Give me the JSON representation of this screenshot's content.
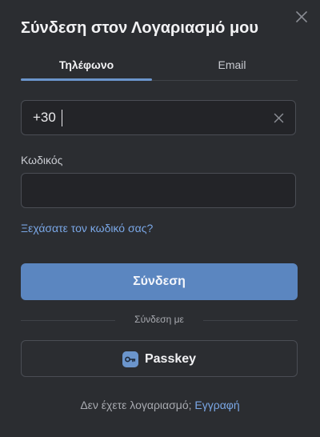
{
  "dialog": {
    "title": "Σύνδεση στον Λογαριασμό μου"
  },
  "tabs": {
    "phone": "Τηλέφωνο",
    "email": "Email"
  },
  "phone": {
    "value": "+30"
  },
  "password": {
    "label": "Κωδικός",
    "value": ""
  },
  "links": {
    "forgot": "Ξεχάσατε τον κωδικό σας?"
  },
  "buttons": {
    "login": "Σύνδεση",
    "passkey": "Passkey"
  },
  "divider": {
    "text": "Σύνδεση με"
  },
  "footer": {
    "prompt": "Δεν έχετε λογαριασμό;",
    "signup": "Εγγραφή"
  },
  "icons": {
    "close": "close-icon",
    "clear": "clear-icon",
    "passkey": "key-icon"
  },
  "colors": {
    "background": "#2b2d31",
    "accent": "#5b86c0",
    "link": "#7aa7e6",
    "field_bg": "#232428",
    "border": "#4a4d54"
  }
}
